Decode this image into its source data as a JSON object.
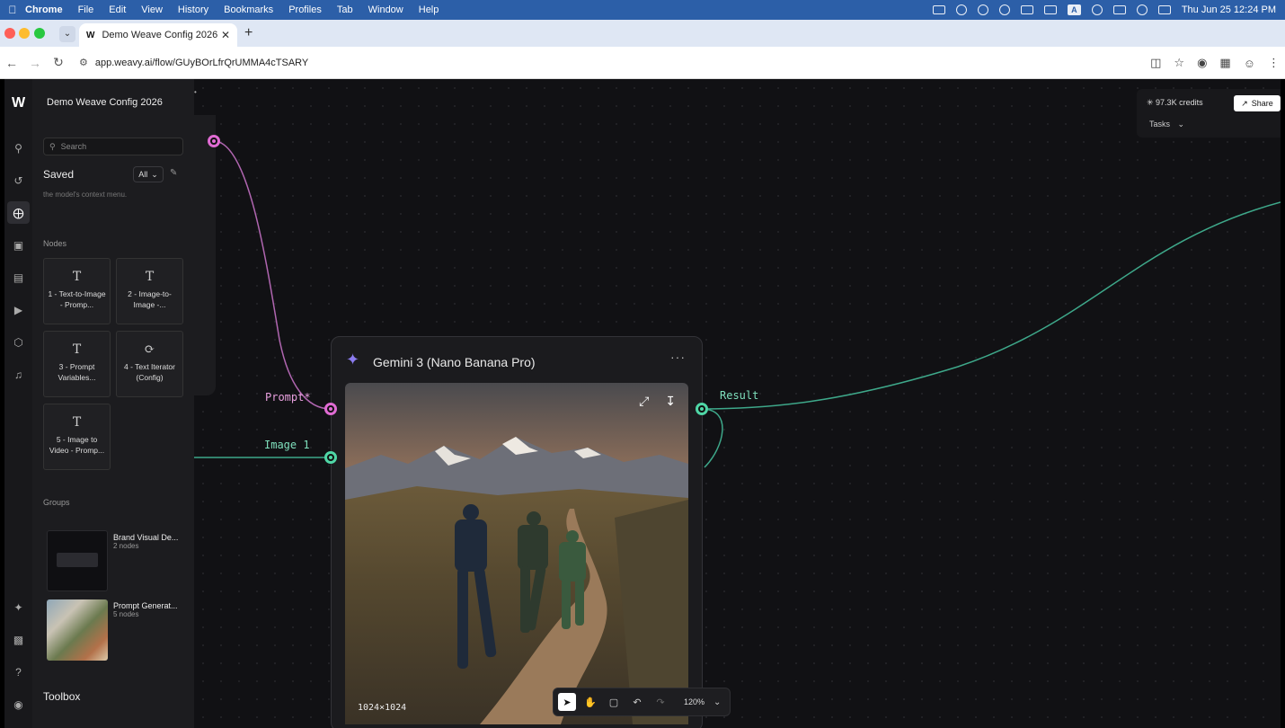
{
  "menubar": {
    "items": [
      "Chrome",
      "File",
      "Edit",
      "View",
      "History",
      "Bookmarks",
      "Profiles",
      "Tab",
      "Window",
      "Help"
    ],
    "datetime": "Thu Jun 25  12:24 PM",
    "input_letter": "A"
  },
  "browser": {
    "tab_title": "Demo Weave Config 2026",
    "tab_favicon": "W",
    "url": "app.weavy.ai/flow/GUyBOrLfrQrUMMA4cTSARY"
  },
  "sidebar": {
    "title": "Demo Weave Config 2026",
    "search_placeholder": "Search",
    "saved_label": "Saved",
    "filter_value": "All",
    "cutoff_text": "the model's context menu.",
    "nodes_heading": "Nodes",
    "nodes": [
      {
        "icon": "T",
        "label": "1 - Text-to-Image - Promp..."
      },
      {
        "icon": "T",
        "label": "2 - Image-to-Image -..."
      },
      {
        "icon": "T",
        "label": "3 - Prompt Variables..."
      },
      {
        "icon": "⟳",
        "label": "4 - Text Iterator (Config)"
      },
      {
        "icon": "T",
        "label": "5 - Image to Video - Promp..."
      }
    ],
    "groups_heading": "Groups",
    "groups": [
      {
        "name": "Brand Visual De...",
        "count": "2 nodes"
      },
      {
        "name": "Prompt Generat...",
        "count": "5 nodes"
      }
    ],
    "toolbox_label": "Toolbox"
  },
  "header": {
    "credits": "97.3K credits",
    "share_label": "Share",
    "tasks_label": "Tasks"
  },
  "node": {
    "title": "Gemini 3 (Nano Banana Pro)",
    "menu": "···",
    "inputs": [
      {
        "label": "Prompt*",
        "color": "#e06bd3"
      },
      {
        "label": "Image 1",
        "color": "#4fd6a6"
      }
    ],
    "output": {
      "label": "Result",
      "color": "#4fd6a6"
    },
    "image_dims": "1024×1024"
  },
  "bottom_toolbar": {
    "zoom": "120%"
  },
  "colors": {
    "accent_pink": "#e06bd3",
    "accent_green": "#4fd6a6",
    "menubar_blue": "#2c5fa8"
  }
}
